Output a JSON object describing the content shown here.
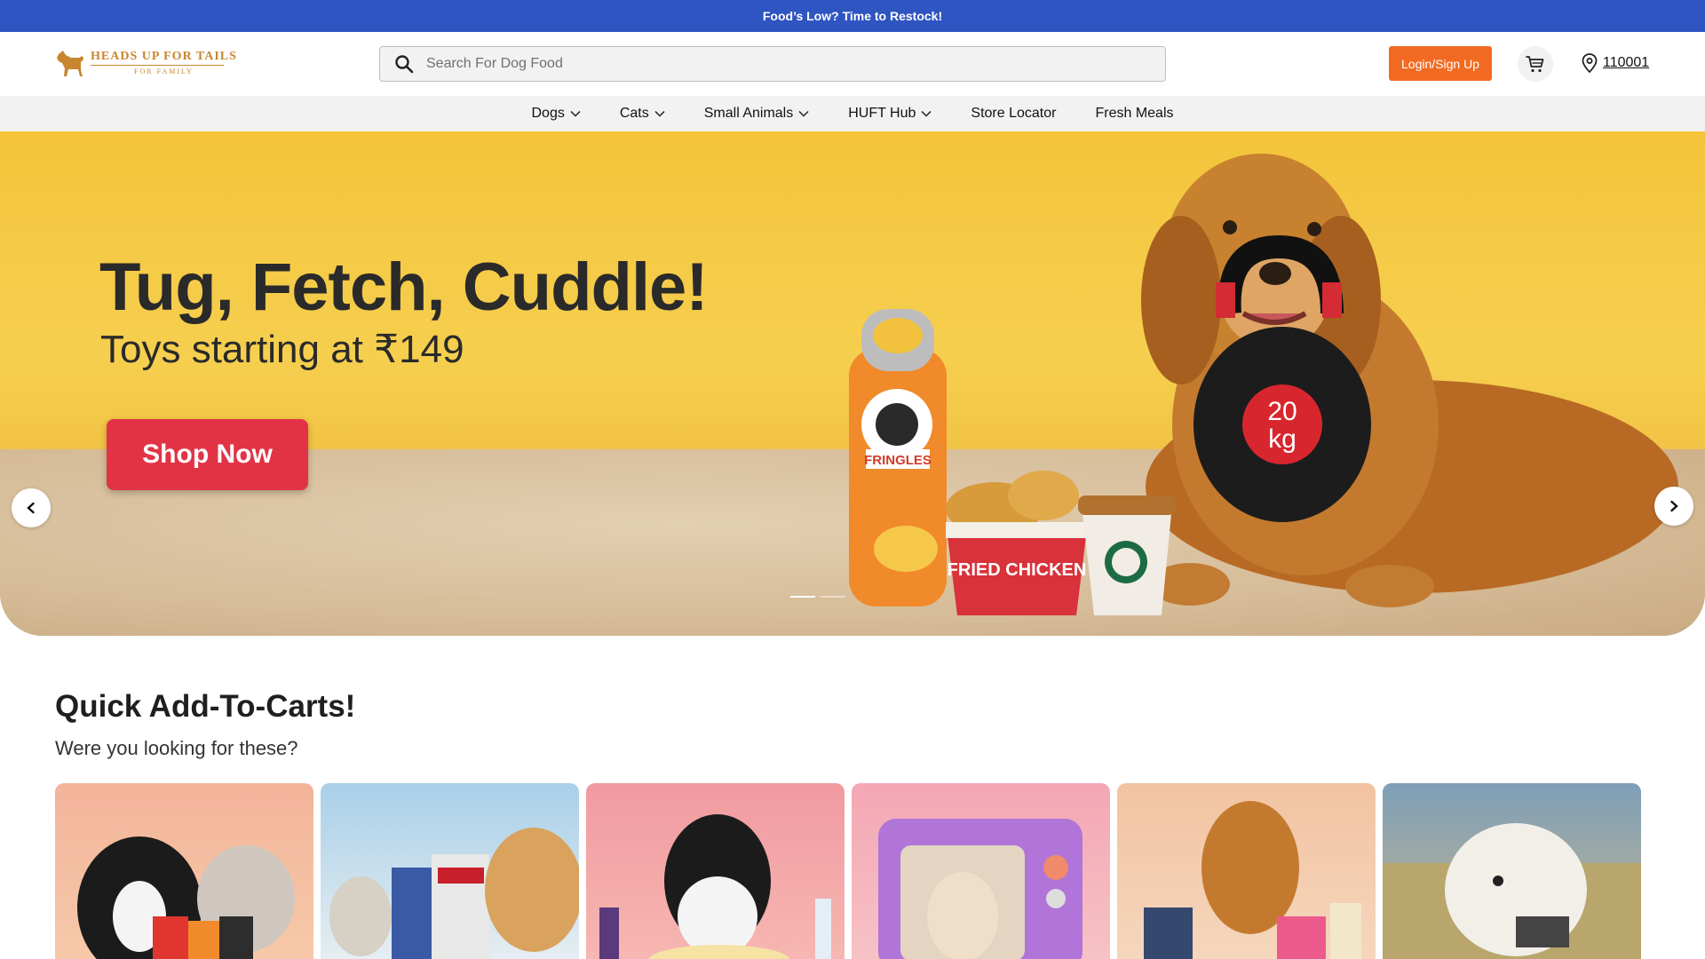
{
  "announcement": {
    "text": "Food’s Low? Time to Restock!"
  },
  "header": {
    "logo": {
      "main": "HEADS UP FOR TAILS",
      "sub": "FOR FAMILY"
    },
    "search": {
      "placeholder": "Search For Dog Food",
      "value": ""
    },
    "login_label": "Login/Sign Up",
    "pincode": "110001"
  },
  "nav": {
    "items": [
      {
        "label": "Dogs",
        "dropdown": true
      },
      {
        "label": "Cats",
        "dropdown": true
      },
      {
        "label": "Small Animals",
        "dropdown": true
      },
      {
        "label": "HUFT Hub",
        "dropdown": true
      },
      {
        "label": "Store Locator",
        "dropdown": false
      },
      {
        "label": "Fresh Meals",
        "dropdown": false
      }
    ]
  },
  "hero": {
    "title": "Tug, Fetch, Cuddle!",
    "subtitle": "Toys starting at ₹149",
    "cta": "Shop Now",
    "kettlebell_top": "20",
    "kettlebell_bottom": "kg",
    "chips_brand": "FRINGLES",
    "bucket_text": "FRIED CHICKEN",
    "slides_total": 2,
    "active_slide": 1
  },
  "quick_add": {
    "title": "Quick Add-To-Carts!",
    "subtitle": "Were you looking for these?",
    "cards": [
      {
        "name": "dog-cat-treats",
        "bg1": "#f3b49a",
        "bg2": "#f6c9a9"
      },
      {
        "name": "dog-food",
        "bg1": "#a9cfe8",
        "bg2": "#e6eef2"
      },
      {
        "name": "grooming",
        "bg1": "#f19aa0",
        "bg2": "#f6b7b2"
      },
      {
        "name": "cat-beds",
        "bg1": "#f3a7b4",
        "bg2": "#f7c2c6"
      },
      {
        "name": "dog-snacks",
        "bg1": "#f2c3a1",
        "bg2": "#f5d7bd"
      },
      {
        "name": "harness",
        "bg1": "#7e9fb8",
        "bg2": "#c7b68d"
      }
    ]
  },
  "colors": {
    "announce_bg": "#2f55c2",
    "accent_orange": "#f26a21",
    "cta_red": "#e23346",
    "hero_yellow": "#f6cf4f"
  }
}
